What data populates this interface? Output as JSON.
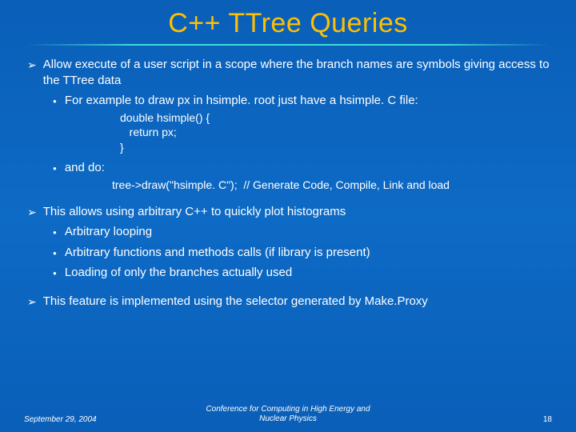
{
  "title": "C++ TTree Queries",
  "bullets": {
    "b1": "Allow execute of a user script in a scope where the branch names are symbols giving access to the TTree data",
    "b1_sub1": "For example to draw px in hsimple. root just have a hsimple. C file:",
    "code1_l1": "double hsimple() {",
    "code1_l2": "   return px;",
    "code1_l3": "}",
    "b1_sub2": "and do:",
    "code2_l1": "tree->draw(\"hsimple. C\");  // Generate Code, Compile, Link and load",
    "b2": "This allows using arbitrary C++ to quickly plot histograms",
    "b2_sub1": "Arbitrary looping",
    "b2_sub2": "Arbitrary functions and methods calls (if library is present)",
    "b2_sub3": "Loading of only the branches actually used",
    "b3": "This feature is implemented using the selector generated by Make.Proxy"
  },
  "footer": {
    "date": "September 29, 2004",
    "conf_l1": "Conference for Computing in High Energy and",
    "conf_l2": "Nuclear Physics",
    "page": "18"
  }
}
